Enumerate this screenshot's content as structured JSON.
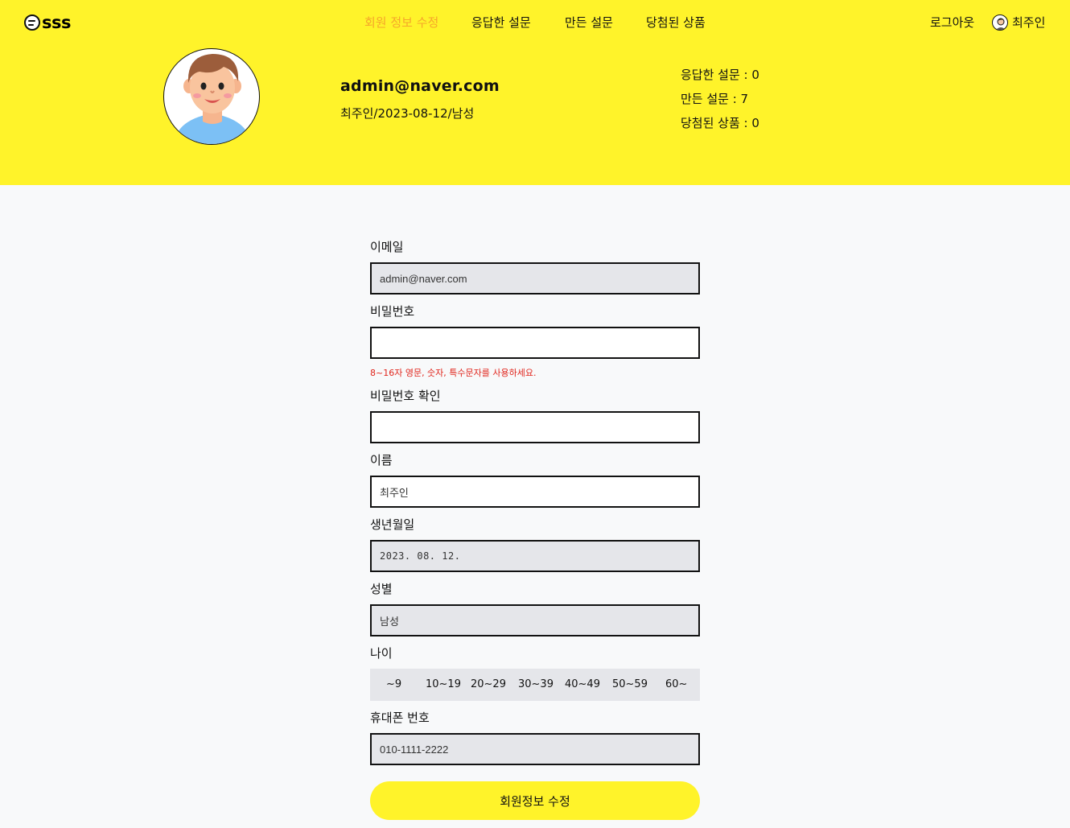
{
  "brand": {
    "name": "sss",
    "icon": "logo-mark-icon",
    "accent": "#fff32a"
  },
  "nav": {
    "items": [
      {
        "label": "회원 정보 수정",
        "active": true
      },
      {
        "label": "응답한 설문",
        "active": false
      },
      {
        "label": "만든 설문",
        "active": false
      },
      {
        "label": "당첨된 상품",
        "active": false
      }
    ],
    "active_color": "#f6a62a"
  },
  "header_right": {
    "logout": "로그아웃",
    "user_name": "최주인",
    "user_icon": "user-avatar-icon"
  },
  "profile": {
    "email": "admin@naver.com",
    "meta": "최주인/2023-08-12/남성",
    "stats": [
      "응답한 설문 : 0",
      "만든 설문 : 7",
      "당첨된 상품 : 0"
    ]
  },
  "form": {
    "email": {
      "label": "이메일",
      "value": "admin@naver.com"
    },
    "password": {
      "label": "비밀번호",
      "value": "",
      "hint": "8~16자 영문, 숫자, 특수문자를 사용하세요."
    },
    "password_confirm": {
      "label": "비밀번호 확인",
      "value": ""
    },
    "name": {
      "label": "이름",
      "value": "최주인"
    },
    "birth": {
      "label": "생년월일",
      "value": "2023. 08. 12."
    },
    "gender": {
      "label": "성별",
      "value": "남성"
    },
    "age": {
      "label": "나이",
      "options": [
        "~9",
        "10~19",
        "20~29",
        "30~39",
        "40~49",
        "50~59",
        "60~"
      ]
    },
    "phone": {
      "label": "휴대폰 번호",
      "value": "010-1111-2222"
    },
    "submit": "회원정보 수정",
    "hint_color": "#e0241b"
  }
}
